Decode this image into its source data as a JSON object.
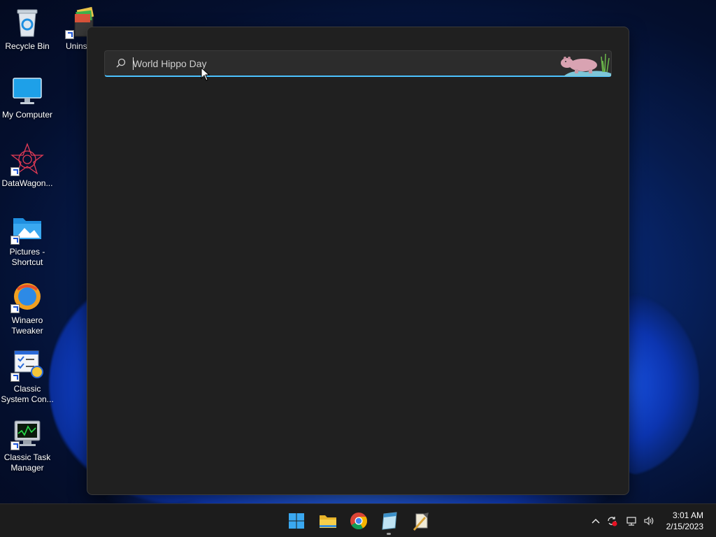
{
  "desktop": {
    "icons": [
      {
        "label": "Recycle Bin",
        "icon": "recycle-bin-icon"
      },
      {
        "label": "Uninstall",
        "icon": "uninstaller-icon"
      },
      {
        "label": "My Computer",
        "icon": "monitor-icon"
      },
      {
        "label": "DataWagon...",
        "icon": "datawagon-icon"
      },
      {
        "label": "Pictures - Shortcut",
        "icon": "pictures-folder-icon"
      },
      {
        "label": "Winaero Tweaker",
        "icon": "winaero-tweaker-icon"
      },
      {
        "label": "Classic System Con...",
        "icon": "system-config-icon"
      },
      {
        "label": "Classic Task Manager",
        "icon": "task-manager-icon"
      }
    ]
  },
  "search": {
    "query": "World Hippo Day",
    "highlight_art": "world-hippo-day-hippo-icon"
  },
  "taskbar": {
    "apps": [
      {
        "name": "start-button",
        "icon": "windows-logo-icon"
      },
      {
        "name": "file-explorer",
        "icon": "folder-icon"
      },
      {
        "name": "chrome",
        "icon": "chrome-icon"
      },
      {
        "name": "notepad-app",
        "icon": "notepad-icon"
      },
      {
        "name": "tweaker-app",
        "icon": "tweaker-icon"
      }
    ],
    "tray": {
      "icons": [
        "chevron-up-icon",
        "sync-icon",
        "network-icon",
        "volume-icon"
      ],
      "time": "3:01 AM",
      "date": "2/15/2023"
    }
  },
  "colors": {
    "accent": "#4cc2ff",
    "panel_bg": "#202020",
    "taskbar_bg": "#1c1c1c"
  }
}
